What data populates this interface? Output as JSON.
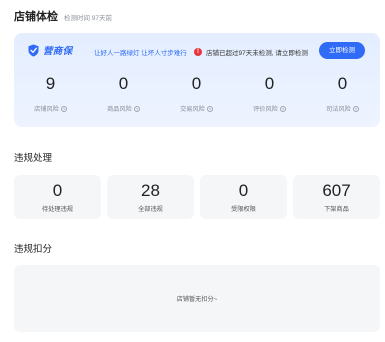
{
  "header": {
    "title": "店铺体检",
    "subtitle": "检测时间 97天前"
  },
  "risk_panel": {
    "brand_name": "营商保",
    "slogan": "让好人一路绿灯 让坏人寸步难行",
    "alert_text": "店铺已超过97天未检测, 请立即检测",
    "check_button": "立即检测",
    "stats": [
      {
        "value": "9",
        "label": "店铺风险"
      },
      {
        "value": "0",
        "label": "商品风险"
      },
      {
        "value": "0",
        "label": "交易风险"
      },
      {
        "value": "0",
        "label": "评价风险"
      },
      {
        "value": "0",
        "label": "司法风险"
      }
    ]
  },
  "violations": {
    "title": "违规处理",
    "cards": [
      {
        "value": "0",
        "label": "待处理违规"
      },
      {
        "value": "28",
        "label": "全部违规"
      },
      {
        "value": "0",
        "label": "受限权限"
      },
      {
        "value": "607",
        "label": "下架商品"
      }
    ]
  },
  "deductions": {
    "title": "违规扣分",
    "empty_text": "店铺暂无扣分~"
  },
  "colors": {
    "accent": "#2f6bf6",
    "alert": "#e8353b",
    "panel_bg": "#e8f0ff",
    "card_bg": "#f5f6f8"
  }
}
